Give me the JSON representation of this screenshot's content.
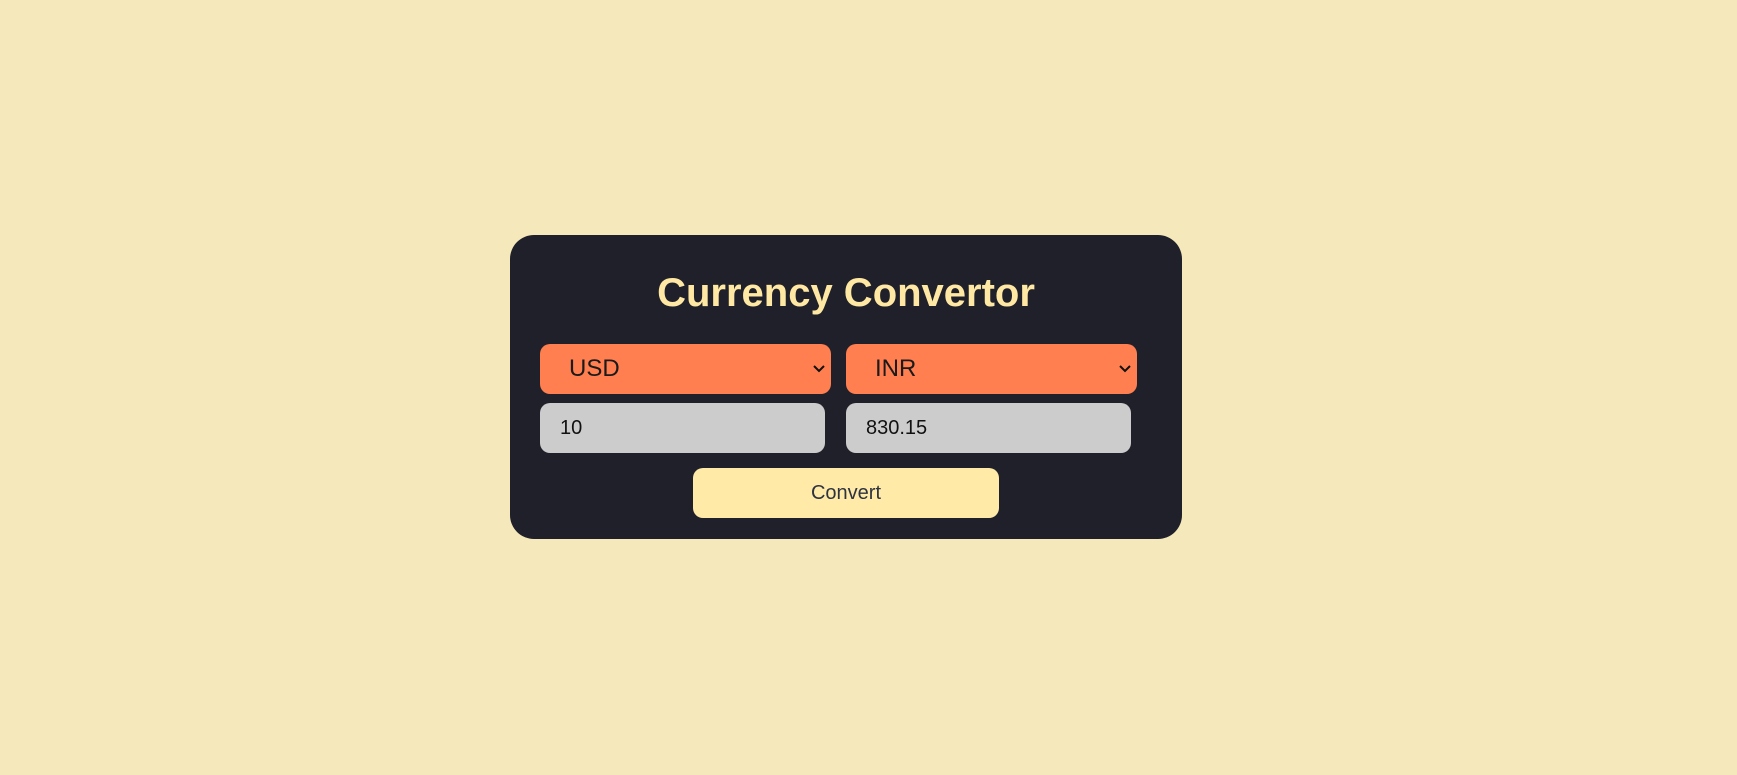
{
  "title": "Currency Convertor",
  "from": {
    "currency": "USD",
    "amount": "10"
  },
  "to": {
    "currency": "INR",
    "amount": "830.15"
  },
  "convert_label": "Convert",
  "colors": {
    "background": "#F5E8BA",
    "card": "#20202A",
    "title": "#FFE8A3",
    "select": "#FF7F50",
    "input": "#CCCCCC",
    "button": "#FFEAA8"
  }
}
